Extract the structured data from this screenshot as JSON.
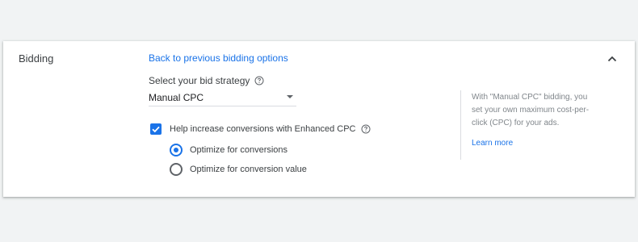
{
  "section": {
    "title": "Bidding"
  },
  "back_link": "Back to previous bidding options",
  "strategy": {
    "label": "Select your bid strategy",
    "selected": "Manual CPC"
  },
  "enhanced_cpc": {
    "label": "Help increase conversions with Enhanced CPC",
    "checked": true
  },
  "options": [
    {
      "label": "Optimize for conversions",
      "selected": true
    },
    {
      "label": "Optimize for conversion value",
      "selected": false
    }
  ],
  "help_panel": {
    "text": "With \"Manual CPC\" bidding, you set your own maximum cost-per-click (CPC) for your ads.",
    "link": "Learn more"
  },
  "colors": {
    "accent": "#1a73e8",
    "background": "#f1f3f4",
    "card": "#ffffff"
  }
}
